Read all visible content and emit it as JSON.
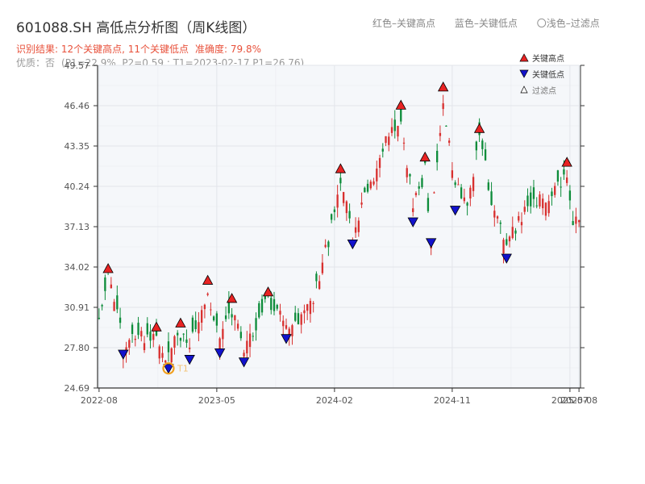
{
  "header": {
    "title": "601088.SH 高低点分析图（周K线图）",
    "legend_red": "红色–关键高点",
    "legend_blue": "蓝色–关键低点",
    "legend_filtered": "〇浅色–过滤点",
    "result_text": "识别结果: 12个关键高点, 11个关键低点",
    "accuracy_text": "准确度: 79.8%",
    "quality_label": "优质：否",
    "params_text": "(P1=22.9%, P2=0.59 ; T1=2023-02-17 P1=26.76)"
  },
  "colors": {
    "up": "#d8302f",
    "down": "#0d8c3a",
    "high_marker": "#e82323",
    "low_marker": "#1212cc",
    "filtered_marker": "#f0a020",
    "plot_bg": "#f5f7fa",
    "grid": "#e2e5ea"
  },
  "chart_data": {
    "type": "candlestick",
    "y_ticks": [
      "24.69",
      "27.80",
      "30.91",
      "34.02",
      "37.13",
      "40.24",
      "43.35",
      "46.46",
      "49.57"
    ],
    "ylim": [
      24.69,
      49.57
    ],
    "x_ticks": [
      {
        "label": "2022-08",
        "i": 0
      },
      {
        "label": "2023-05",
        "i": 39
      },
      {
        "label": "2024-02",
        "i": 78
      },
      {
        "label": "2024-11",
        "i": 117
      },
      {
        "label": "2025-07",
        "i": 156
      },
      {
        "label": "2025-08",
        "i": 159
      }
    ],
    "legend": [
      "关键高点",
      "关键低点",
      "过滤点"
    ],
    "annotation": "T1",
    "anchors": [
      [
        0,
        29.5
      ],
      [
        3,
        33.2
      ],
      [
        8,
        28.0
      ],
      [
        14,
        28.8
      ],
      [
        16,
        28.2
      ],
      [
        19,
        28.3
      ],
      [
        23,
        27.1
      ],
      [
        27,
        29.0
      ],
      [
        30,
        27.8
      ],
      [
        36,
        32.5
      ],
      [
        40,
        28.0
      ],
      [
        44,
        30.8
      ],
      [
        48,
        27.5
      ],
      [
        53,
        30.0
      ],
      [
        56,
        31.5
      ],
      [
        62,
        29.2
      ],
      [
        70,
        31.0
      ],
      [
        76,
        36.0
      ],
      [
        80,
        41.0
      ],
      [
        84,
        36.3
      ],
      [
        89,
        40.0
      ],
      [
        96,
        44.0
      ],
      [
        100,
        45.8
      ],
      [
        104,
        38.5
      ],
      [
        108,
        41.5
      ],
      [
        110,
        36.5
      ],
      [
        114,
        47.2
      ],
      [
        118,
        40.0
      ],
      [
        122,
        39.3
      ],
      [
        126,
        44.0
      ],
      [
        131,
        38.2
      ],
      [
        135,
        35.5
      ],
      [
        139,
        37.5
      ],
      [
        146,
        39.5
      ],
      [
        152,
        40.0
      ],
      [
        155,
        41.4
      ],
      [
        157,
        37.3
      ],
      [
        159,
        38.0
      ]
    ],
    "key_highs": [
      {
        "i": 3,
        "price": 33.4
      },
      {
        "i": 19,
        "price": 28.9
      },
      {
        "i": 27,
        "price": 29.2
      },
      {
        "i": 36,
        "price": 32.5
      },
      {
        "i": 44,
        "price": 31.1
      },
      {
        "i": 56,
        "price": 31.6
      },
      {
        "i": 80,
        "price": 41.1
      },
      {
        "i": 100,
        "price": 46.0
      },
      {
        "i": 108,
        "price": 42.0
      },
      {
        "i": 114,
        "price": 47.4
      },
      {
        "i": 126,
        "price": 44.2
      },
      {
        "i": 155,
        "price": 41.6
      }
    ],
    "key_lows": [
      {
        "i": 8,
        "price": 27.8
      },
      {
        "i": 23,
        "price": 26.7
      },
      {
        "i": 30,
        "price": 27.4
      },
      {
        "i": 40,
        "price": 27.9
      },
      {
        "i": 48,
        "price": 27.2
      },
      {
        "i": 62,
        "price": 29.0
      },
      {
        "i": 84,
        "price": 36.3
      },
      {
        "i": 104,
        "price": 38.0
      },
      {
        "i": 110,
        "price": 36.4
      },
      {
        "i": 118,
        "price": 38.9
      },
      {
        "i": 135,
        "price": 35.2
      }
    ],
    "filtered_point": {
      "i": 23,
      "price": 26.7
    }
  }
}
